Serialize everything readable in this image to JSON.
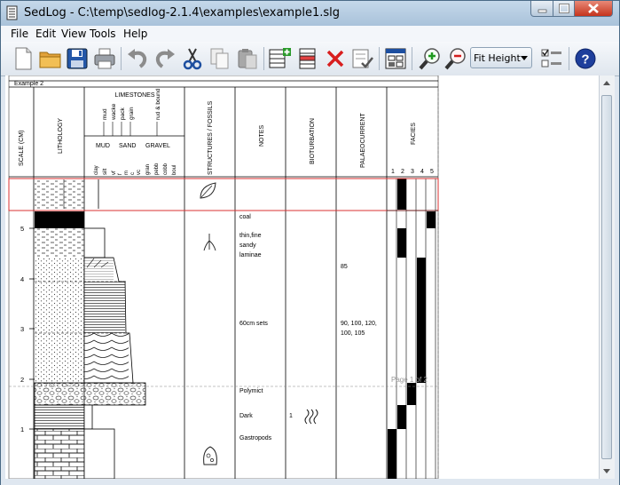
{
  "window": {
    "title": "SedLog - C:\\temp\\sedlog-2.1.4\\examples\\example1.slg"
  },
  "menu": {
    "items": [
      "File",
      "Edit",
      "View",
      "Tools",
      "Help"
    ]
  },
  "toolbar": {
    "buttons": [
      {
        "icon": "new-document-icon"
      },
      {
        "icon": "open-folder-icon"
      },
      {
        "icon": "save-disk-icon"
      },
      {
        "icon": "print-icon"
      },
      {
        "icon": "undo-icon"
      },
      {
        "icon": "redo-icon"
      },
      {
        "icon": "cut-scissors-icon"
      },
      {
        "icon": "copy-icon"
      },
      {
        "icon": "paste-icon"
      },
      {
        "icon": "add-bed-icon"
      },
      {
        "icon": "insert-bed-icon"
      },
      {
        "icon": "delete-icon"
      },
      {
        "icon": "check-edit-icon"
      },
      {
        "icon": "column-layout-icon"
      },
      {
        "icon": "zoom-in-icon"
      },
      {
        "icon": "zoom-out-icon"
      },
      {
        "icon": "column-options-icon"
      },
      {
        "icon": "help-icon"
      }
    ],
    "zoom_select": {
      "value": "Fit Height"
    }
  },
  "log": {
    "title": "Example 2",
    "columns": {
      "scale": "SCALE (CM)",
      "lithology": "LITHOLOGY",
      "limestones": "LIMESTONES",
      "limestone_types": [
        "mud",
        "wacke",
        "pack",
        "grain",
        "rud &\nbound"
      ],
      "mud": "MUD",
      "sand": "SAND",
      "gravel": "GRAVEL",
      "grain_sizes": [
        "clay",
        "silt",
        "vf",
        "f",
        "m",
        "c",
        "vc",
        "gran",
        "pebb",
        "cobb",
        "boul"
      ],
      "structures": "STRUCTURES / FOSSILS",
      "notes": "NOTES",
      "bioturbation": "BIOTURBATION",
      "palaeocurrent": "PALAEOCURRENT",
      "facies": "FACIES",
      "facies_numbers": [
        "1",
        "2",
        "3",
        "4",
        "5"
      ]
    },
    "scale_labels": [
      "5",
      "4",
      "3",
      "2",
      "1"
    ],
    "notes": [
      "coal",
      "thin,fine",
      "sandy",
      "laminae",
      "60cm sets",
      "Polymict",
      "Dark",
      "Gastropods"
    ],
    "bioturbation_value": "1",
    "palaeocurrent": [
      "85",
      "90, 100, 120,",
      "100, 105"
    ],
    "page_label": "Page 1 of 2"
  }
}
